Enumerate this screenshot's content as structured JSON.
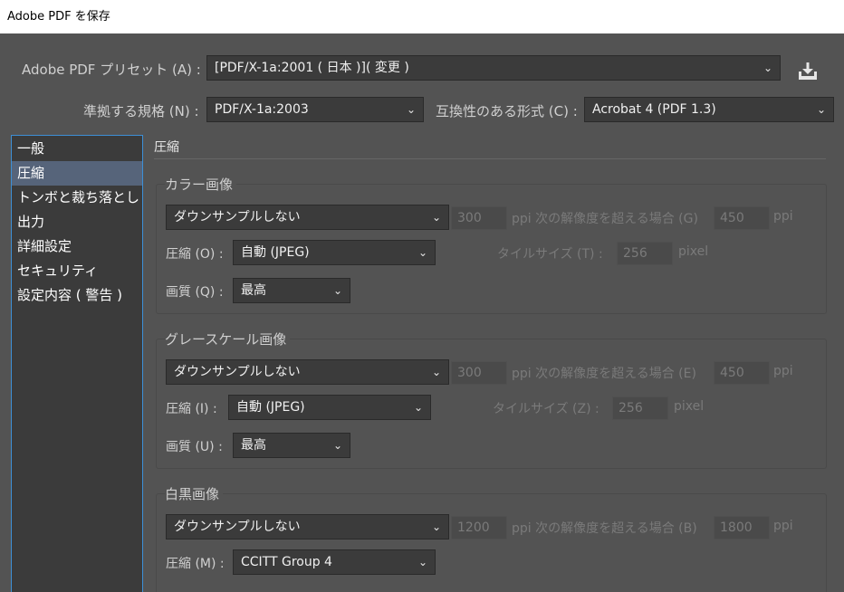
{
  "window": {
    "title": "Adobe PDF を保存"
  },
  "preset": {
    "label": "Adobe PDF プリセット (A) :",
    "value": "[PDF/X-1a:2001 ( 日本 )]( 変更 )",
    "save_icon": "save-preset-icon"
  },
  "standard": {
    "label": "準拠する規格 (N) :",
    "value": "PDF/X-1a:2003"
  },
  "compat": {
    "label": "互換性のある形式 (C) :",
    "value": "Acrobat 4 (PDF 1.3)"
  },
  "sidebar": {
    "items": [
      {
        "label": "一般"
      },
      {
        "label": "圧縮"
      },
      {
        "label": "トンボと裁ち落とし"
      },
      {
        "label": "出力"
      },
      {
        "label": "詳細設定"
      },
      {
        "label": "セキュリティ"
      },
      {
        "label": "設定内容 ( 警告 )"
      }
    ],
    "selected_index": 1
  },
  "main": {
    "title": "圧縮",
    "color": {
      "title": "カラー画像",
      "downsample": "ダウンサンプルしない",
      "ppi_value": "300",
      "ppi_text": "ppi 次の解像度を超える場合 (G)",
      "ppi_above": "450",
      "ppi_unit": "ppi",
      "compression_label": "圧縮 (O) :",
      "compression_value": "自動 (JPEG)",
      "tile_label": "タイルサイズ (T) :",
      "tile_value": "256",
      "tile_unit": "pixel",
      "quality_label": "画質 (Q) :",
      "quality_value": "最高"
    },
    "gray": {
      "title": "グレースケール画像",
      "downsample": "ダウンサンプルしない",
      "ppi_value": "300",
      "ppi_text": "ppi 次の解像度を超える場合 (E)",
      "ppi_above": "450",
      "ppi_unit": "ppi",
      "compression_label": "圧縮 (I) :",
      "compression_value": "自動 (JPEG)",
      "tile_label": "タイルサイズ (Z) :",
      "tile_value": "256",
      "tile_unit": "pixel",
      "quality_label": "画質 (U) :",
      "quality_value": "最高"
    },
    "mono": {
      "title": "白黒画像",
      "downsample": "ダウンサンプルしない",
      "ppi_value": "1200",
      "ppi_text": "ppi 次の解像度を超える場合 (B)",
      "ppi_above": "1800",
      "ppi_unit": "ppi",
      "compression_label": "圧縮 (M) :",
      "compression_value": "CCITT Group 4"
    }
  },
  "colors": {
    "panel_bg": "#535353",
    "field_bg": "#3b3b3b",
    "selection": "#56647a",
    "focus_border": "#3d8fd6"
  }
}
